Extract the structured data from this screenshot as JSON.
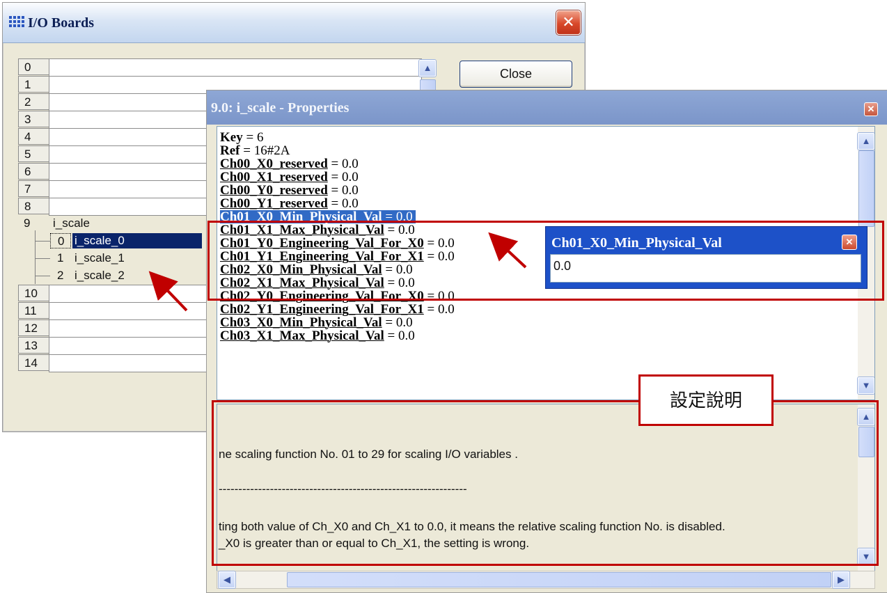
{
  "io_window": {
    "title": "I/O Boards",
    "close_button": "Close",
    "rows": [
      {
        "num": "0",
        "name": ""
      },
      {
        "num": "1",
        "name": ""
      },
      {
        "num": "2",
        "name": ""
      },
      {
        "num": "3",
        "name": ""
      },
      {
        "num": "4",
        "name": ""
      },
      {
        "num": "5",
        "name": ""
      },
      {
        "num": "6",
        "name": ""
      },
      {
        "num": "7",
        "name": ""
      },
      {
        "num": "8",
        "name": ""
      },
      {
        "num": "9",
        "name": "i_scale"
      },
      {
        "num": "10",
        "name": ""
      },
      {
        "num": "11",
        "name": ""
      },
      {
        "num": "12",
        "name": ""
      },
      {
        "num": "13",
        "name": ""
      },
      {
        "num": "14",
        "name": ""
      }
    ],
    "sub_items": [
      {
        "num": "0",
        "name": "i_scale_0",
        "selected": true
      },
      {
        "num": "1",
        "name": "i_scale_1",
        "selected": false
      },
      {
        "num": "2",
        "name": "i_scale_2",
        "selected": false
      }
    ]
  },
  "properties_window": {
    "title": "9.0: i_scale - Properties",
    "items": [
      {
        "key": "Key",
        "value": "6"
      },
      {
        "key": "Ref",
        "value": "16#2A"
      },
      {
        "key": "Ch00_X0_reserved",
        "value": "0.0"
      },
      {
        "key": "Ch00_X1_reserved",
        "value": "0.0"
      },
      {
        "key": "Ch00_Y0_reserved",
        "value": "0.0"
      },
      {
        "key": "Ch00_Y1_reserved",
        "value": "0.0"
      },
      {
        "key": "Ch01_X0_Min_Physical_Val",
        "value": "0.0"
      },
      {
        "key": "Ch01_X1_Max_Physical_Val",
        "value": "0.0"
      },
      {
        "key": "Ch01_Y0_Engineering_Val_For_X0",
        "value": "0.0"
      },
      {
        "key": "Ch01_Y1_Engineering_Val_For_X1",
        "value": "0.0"
      },
      {
        "key": "Ch02_X0_Min_Physical_Val",
        "value": "0.0"
      },
      {
        "key": "Ch02_X1_Max_Physical_Val",
        "value": "0.0"
      },
      {
        "key": "Ch02_Y0_Engineering_Val_For_X0",
        "value": "0.0"
      },
      {
        "key": "Ch02_Y1_Engineering_Val_For_X1",
        "value": "0.0"
      },
      {
        "key": "Ch03_X0_Min_Physical_Val",
        "value": "0.0"
      },
      {
        "key": "Ch03_X1_Max_Physical_Val",
        "value": "0.0"
      }
    ],
    "selected_item": "Ch01_X0_Min_Physical_Val",
    "description": {
      "line1": "ne scaling function No. 01 to 29 for scaling I/O variables .",
      "line2": "---------------------------------------------------------------",
      "line3": "ting both value of Ch_X0 and Ch_X1 to 0.0, it means the relative scaling function No. is disabled.",
      "line4": "_X0 is greater than or equal to Ch_X1, the setting is wrong."
    }
  },
  "value_editor": {
    "title": "Ch01_X0_Min_Physical_Val",
    "value": "0.0"
  },
  "annotation": {
    "callout_label": "設定說明",
    "color": "#c00000"
  },
  "colors": {
    "selection": "#316ac5",
    "tree_selection": "#0a246a",
    "editor_title": "#1d51c8"
  }
}
